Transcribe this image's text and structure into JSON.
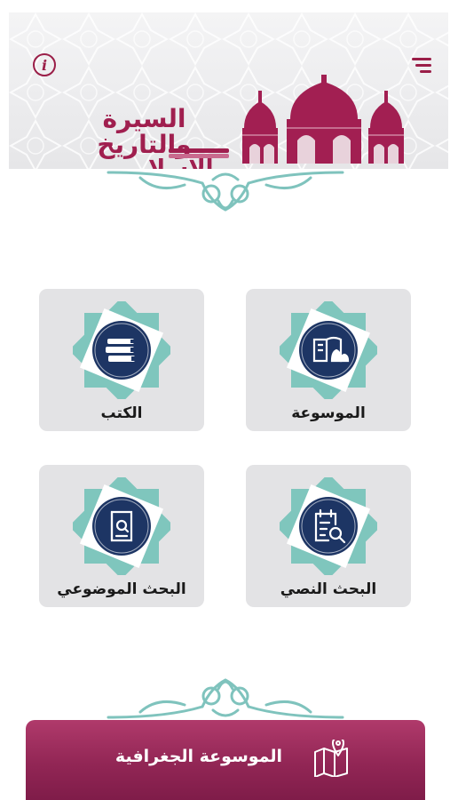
{
  "header": {
    "logo_line1": "السيرة والتاريخ",
    "logo_line2": "الإسلامي",
    "info_icon": "info-icon",
    "menu_icon": "menu-icon"
  },
  "cards": [
    {
      "label": "الكتب",
      "icon": "books-icon"
    },
    {
      "label": "الموسوعة",
      "icon": "encyclopedia-icon"
    },
    {
      "label": "البحث الموضوعي",
      "icon": "book-search-icon"
    },
    {
      "label": "البحث النصي",
      "icon": "text-search-icon"
    }
  ],
  "bottom_bar": {
    "label": "الموسوعة الجغرافية",
    "icon": "map-pin-icon"
  },
  "colors": {
    "brand": "#9a1e48",
    "badge_navy": "#1d3564",
    "badge_teal": "#6fc3bb",
    "card_bg": "#e3e3e5"
  }
}
